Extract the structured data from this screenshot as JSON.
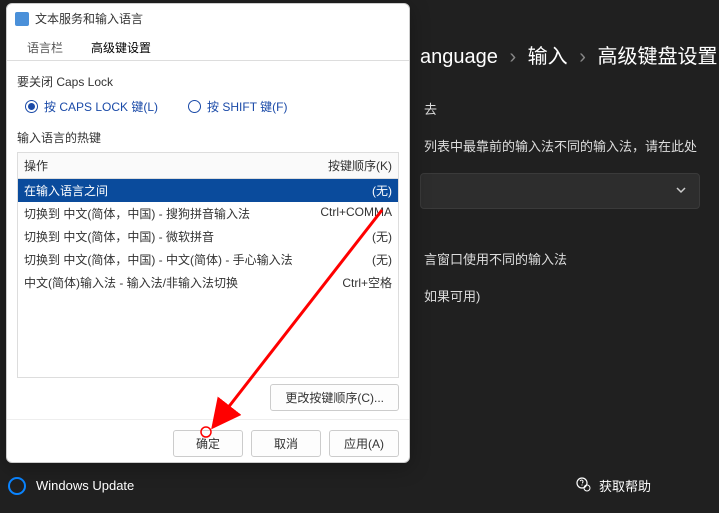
{
  "background": {
    "breadcrumb": {
      "item1": "anguage",
      "item2": "输入",
      "item3": "高级键盘设置"
    },
    "line1_suffix": "去",
    "line2": "列表中最靠前的输入法不同的输入法，请在此处",
    "line3": "言窗口使用不同的输入法",
    "line4": "如果可用)",
    "windows_update": "Windows Update",
    "get_help": "获取帮助"
  },
  "dialog": {
    "title": "文本服务和输入语言",
    "tabs": {
      "tab1": "语言栏",
      "tab2": "高级键设置"
    },
    "caps_lock_label": "要关闭 Caps Lock",
    "radio1": "按 CAPS LOCK 键(L)",
    "radio2": "按 SHIFT 键(F)",
    "hotkey_section_label": "输入语言的热键",
    "col1": "操作",
    "col2": "按键顺序(K)",
    "rows": [
      {
        "action": "在输入语言之间",
        "key": "(无)"
      },
      {
        "action": "切换到 中文(简体，中国) - 搜狗拼音输入法",
        "key": "Ctrl+COMMA"
      },
      {
        "action": "切换到 中文(简体，中国) - 微软拼音",
        "key": "(无)"
      },
      {
        "action": "切换到 中文(简体，中国) - 中文(简体) - 手心输入法",
        "key": "(无)"
      },
      {
        "action": "中文(简体)输入法 - 输入法/非输入法切换",
        "key": "Ctrl+空格"
      }
    ],
    "change_btn": "更改按键顺序(C)...",
    "ok": "确定",
    "cancel": "取消",
    "apply": "应用(A)"
  }
}
